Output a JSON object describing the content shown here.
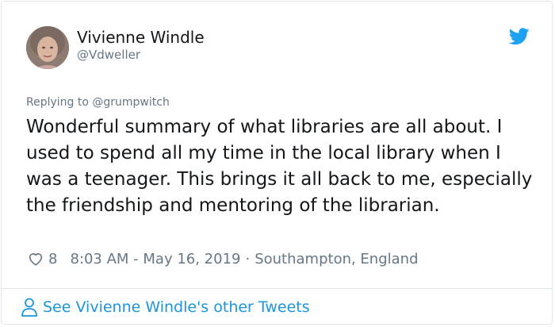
{
  "author": {
    "name": "Vivienne Windle",
    "handle": "@Vdweller"
  },
  "reply": {
    "prefix": "Replying to",
    "mention": "@grumpwitch"
  },
  "tweet": {
    "text": "Wonderful summary of what libraries are all about. I used to spend all my time in the local library when I was a teenager. This brings it all back to me, especially the friendship and mentoring of the librarian.",
    "likes": "8",
    "time": "8:03 AM - May 16, 2019",
    "separator": "·",
    "location": "Southampton, England"
  },
  "footer": {
    "link_label": "See Vivienne Windle's other Tweets"
  },
  "icons": {
    "brand": "twitter-bird-icon",
    "like": "heart-icon",
    "profile": "person-icon"
  },
  "colors": {
    "brand_blue": "#1da1f2",
    "link_blue": "#1b95e0",
    "muted_gray": "#657786",
    "text": "#14171a",
    "border": "#e1e8ed"
  }
}
